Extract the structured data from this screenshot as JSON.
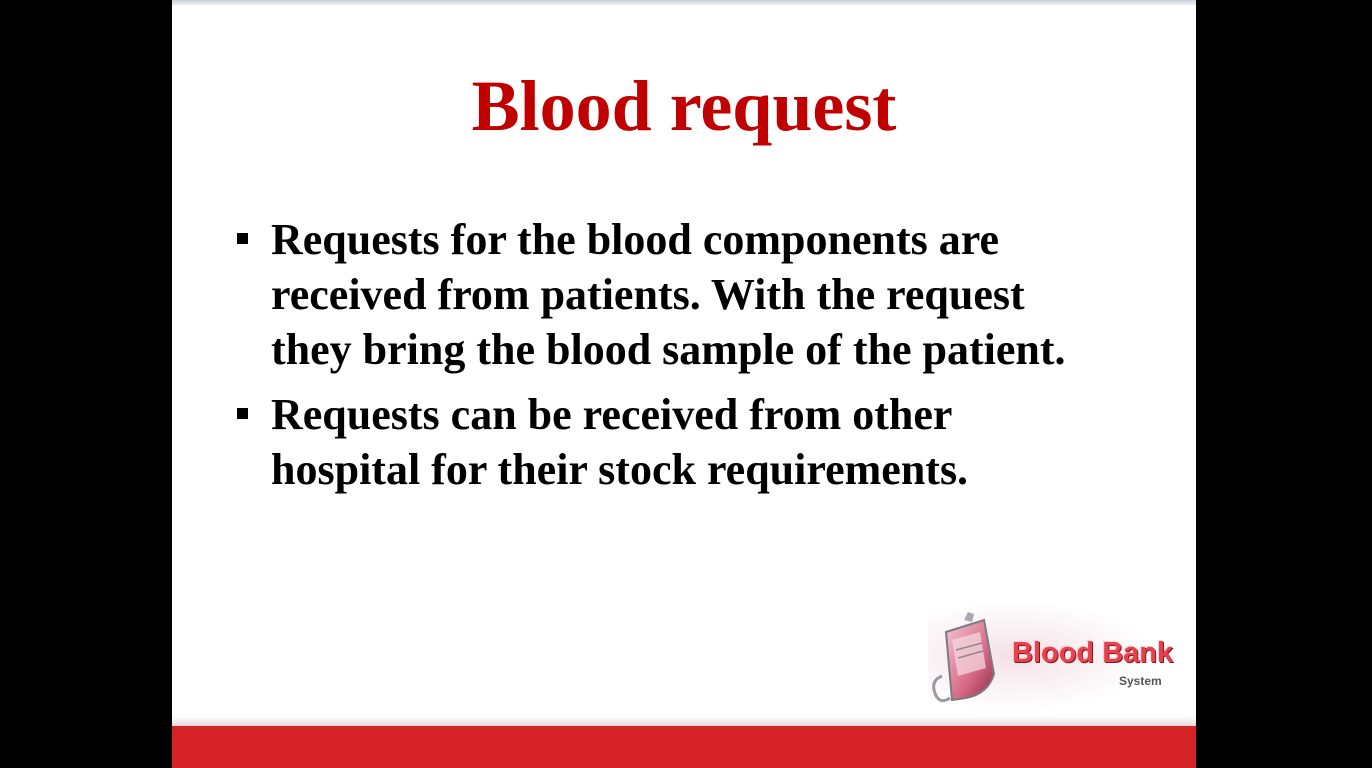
{
  "slide": {
    "title": "Blood request",
    "bullets": [
      {
        "text": "Requests for the blood components are\nreceived from patients.  With the request\nthey bring the blood sample of the patient."
      },
      {
        "text": "Requests can be received from other\nhospital for their stock requirements."
      }
    ],
    "logo": {
      "title": "Blood Bank",
      "subtitle": "System",
      "icon": "blood-bag-icon"
    }
  },
  "colors": {
    "title": "#c00000",
    "footer_bar": "#d42226",
    "background": "#000000",
    "slide": "#ffffff"
  }
}
